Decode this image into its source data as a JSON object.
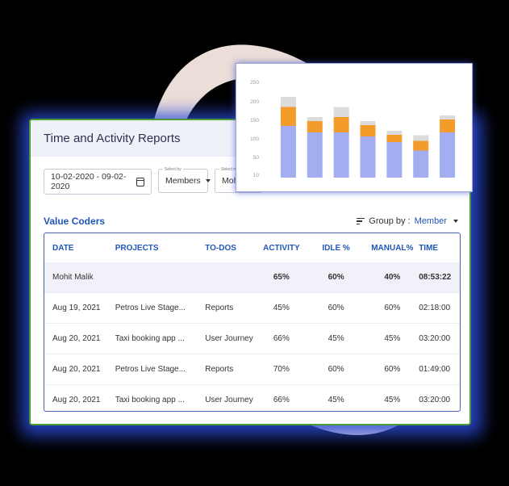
{
  "colors": {
    "primary_blue": "#2157b8",
    "bar_base": "#a3aef0",
    "bar_mid": "#f39c2c",
    "bar_top": "#dcdcdc",
    "card_border": "#4c9a36"
  },
  "report": {
    "title": "Time and Activity Reports",
    "date_range": "10-02-2020 - 09-02-2020",
    "calendar_icon": "calendar-icon",
    "select_by_label": "Select by",
    "select_by_value": "Members",
    "select_member_label": "Select m",
    "select_member_value": "Moh",
    "section_title": "Value Coders",
    "group_by_label": "Group by :",
    "group_by_value": "Member"
  },
  "table": {
    "headers": [
      "DATE",
      "PROJECTS",
      "TO-DOS",
      "ACTIVITY",
      "IDLE %",
      "MANUAL%",
      "TIME"
    ],
    "summary": {
      "name": "Mohit Malik",
      "activity": "65%",
      "idle": "60%",
      "manual": "40%",
      "time": "08:53:22"
    },
    "rows": [
      {
        "date": " Aug 19, 2021",
        "project": "Petros Live Stage...",
        "todo": "Reports",
        "activity": "45%",
        "idle": "60%",
        "manual": "60%",
        "time": "02:18:00"
      },
      {
        "date": "Aug 20, 2021",
        "project": "Taxi booking app ...",
        "todo": "User Journey",
        "activity": "66%",
        "idle": "45%",
        "manual": "45%",
        "time": "03:20:00"
      },
      {
        "date": "Aug 20, 2021",
        "project": "Petros Live Stage...",
        "todo": "Reports",
        "activity": "70%",
        "idle": "60%",
        "manual": "60%",
        "time": "01:49:00"
      },
      {
        "date": "Aug 20, 2021",
        "project": "Taxi booking app ...",
        "todo": "User Journey",
        "activity": "66%",
        "idle": "45%",
        "manual": "45%",
        "time": "03:20:00"
      }
    ]
  },
  "chart_data": {
    "type": "bar",
    "stacked": true,
    "yticks": [
      10,
      50,
      100,
      150,
      200,
      250
    ],
    "ylim": [
      0,
      250
    ],
    "categories": [
      "",
      "",
      "",
      "",
      "",
      "",
      ""
    ],
    "series": [
      {
        "color": "#a3aef0",
        "values": [
          128,
          112,
          112,
          102,
          88,
          67,
          112
        ]
      },
      {
        "color": "#f39c2c",
        "values": [
          47,
          28,
          38,
          28,
          18,
          24,
          32
        ]
      },
      {
        "color": "#dcdcdc",
        "values": [
          25,
          10,
          25,
          10,
          10,
          14,
          10
        ]
      }
    ],
    "grid": false,
    "legend": "none"
  }
}
